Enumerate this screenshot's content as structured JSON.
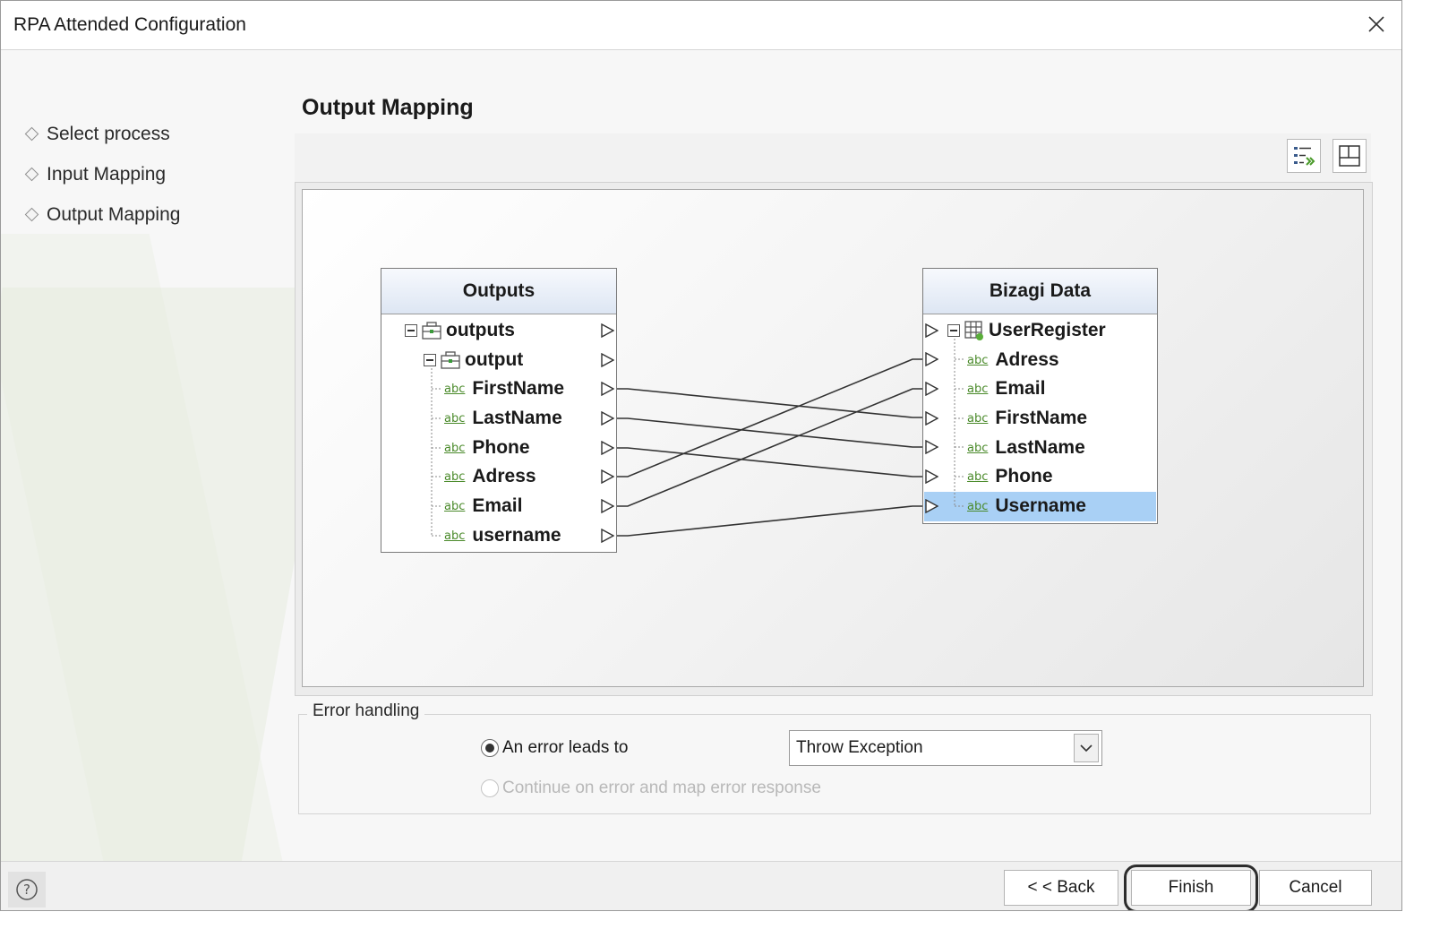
{
  "window": {
    "title": "RPA Attended Configuration"
  },
  "steps": [
    {
      "label": "Select process"
    },
    {
      "label": "Input Mapping"
    },
    {
      "label": "Output Mapping"
    }
  ],
  "page": {
    "title": "Output Mapping"
  },
  "toolbar": {
    "buttons": [
      {
        "icon": "auto-map-icon"
      },
      {
        "icon": "layout-icon"
      }
    ]
  },
  "mapping": {
    "source": {
      "title": "Outputs",
      "rows": [
        {
          "label": "outputs",
          "kind": "object"
        },
        {
          "label": "output",
          "kind": "object"
        },
        {
          "label": "FirstName",
          "kind": "string",
          "type_tag": "abc"
        },
        {
          "label": "LastName",
          "kind": "string",
          "type_tag": "abc"
        },
        {
          "label": "Phone",
          "kind": "string",
          "type_tag": "abc"
        },
        {
          "label": "Adress",
          "kind": "string",
          "type_tag": "abc"
        },
        {
          "label": "Email",
          "kind": "string",
          "type_tag": "abc"
        },
        {
          "label": "username",
          "kind": "string",
          "type_tag": "abc"
        }
      ]
    },
    "target": {
      "title": "Bizagi Data",
      "rows": [
        {
          "label": "UserRegister",
          "kind": "entity"
        },
        {
          "label": "Adress",
          "kind": "string",
          "type_tag": "abc"
        },
        {
          "label": "Email",
          "kind": "string",
          "type_tag": "abc"
        },
        {
          "label": "FirstName",
          "kind": "string",
          "type_tag": "abc"
        },
        {
          "label": "LastName",
          "kind": "string",
          "type_tag": "abc"
        },
        {
          "label": "Phone",
          "kind": "string",
          "type_tag": "abc"
        },
        {
          "label": "Username",
          "kind": "string",
          "type_tag": "abc",
          "selected": true
        }
      ]
    },
    "connections": [
      {
        "from": "FirstName",
        "to": "FirstName"
      },
      {
        "from": "LastName",
        "to": "LastName"
      },
      {
        "from": "Phone",
        "to": "Phone"
      },
      {
        "from": "Adress",
        "to": "Adress"
      },
      {
        "from": "Email",
        "to": "Email"
      },
      {
        "from": "username",
        "to": "Username"
      }
    ]
  },
  "error_handling": {
    "legend": "Error handling",
    "option_error": {
      "label": "An error leads to",
      "checked": true
    },
    "option_continue": {
      "label": "Continue on error and map error response",
      "enabled": false
    },
    "action_select": {
      "value": "Throw Exception"
    }
  },
  "footer": {
    "help_icon": "help-icon",
    "back_label": "< < Back",
    "finish_label": "Finish",
    "cancel_label": "Cancel"
  },
  "colors": {
    "selected_row": "#a9d0f5",
    "header_gradient": "#dde6f3",
    "string_tag": "#4a8a2a"
  }
}
